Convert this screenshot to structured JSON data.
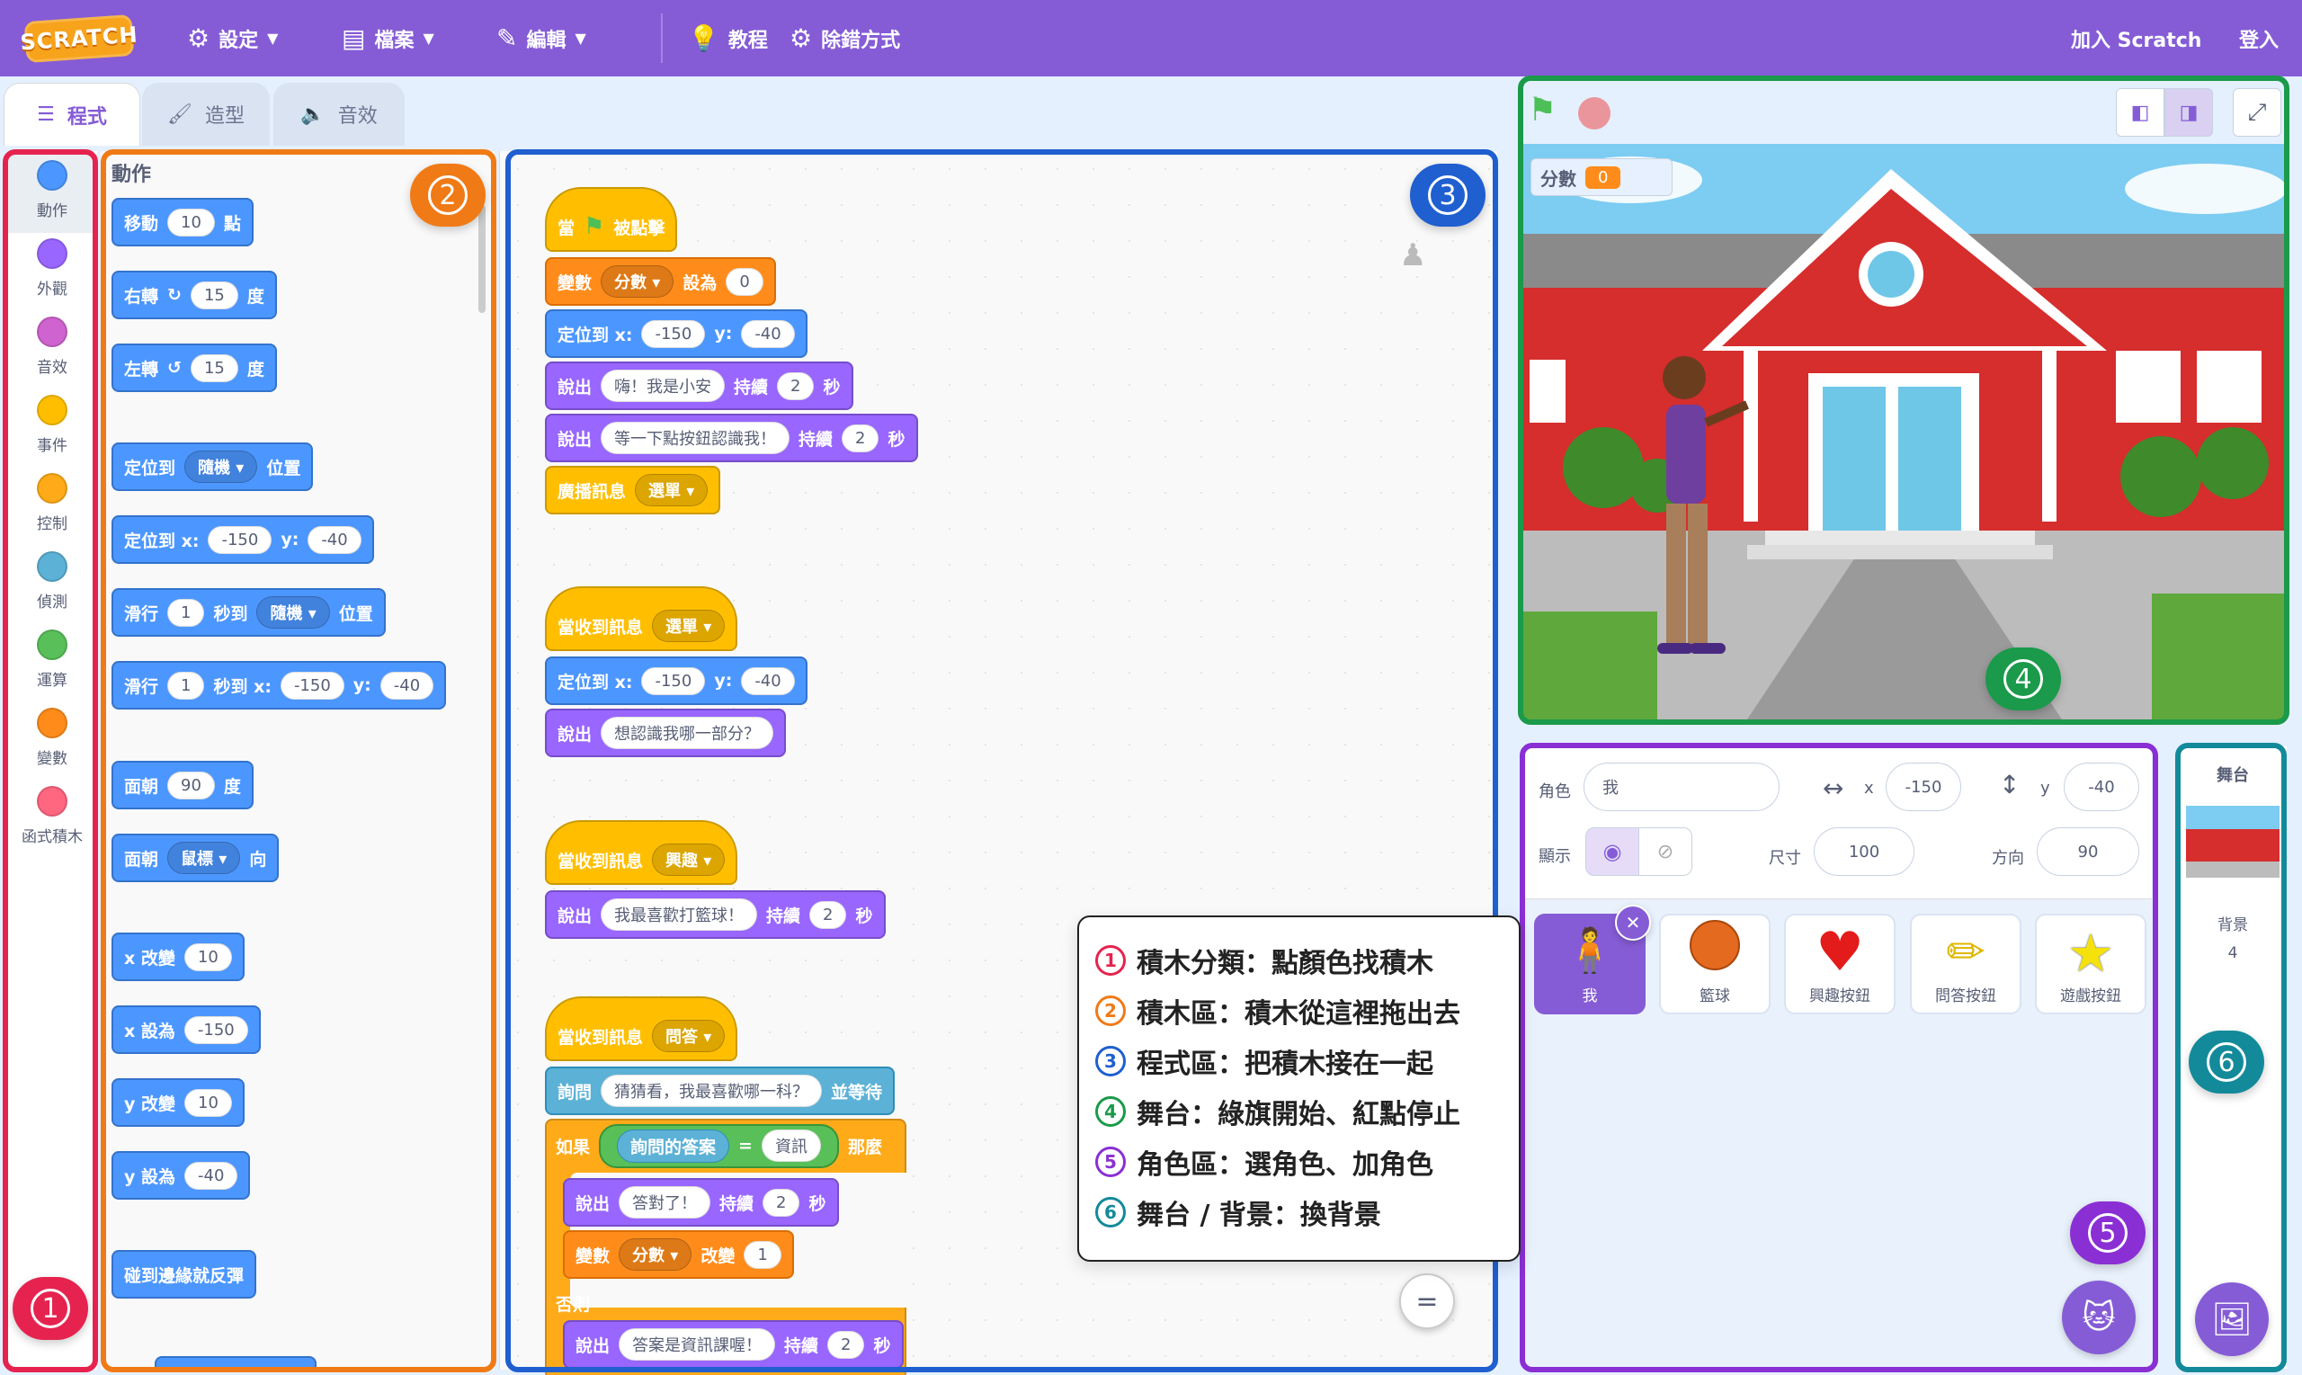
{
  "menubar": {
    "logo": "SCRATCH",
    "settings": "設定",
    "file": "檔案",
    "edit": "編輯",
    "tutorials": "教程",
    "debug": "除錯方式",
    "join": "加入 Scratch",
    "signin": "登入"
  },
  "tabs": {
    "code": "程式",
    "costumes": "造型",
    "sounds": "音效"
  },
  "categories": [
    {
      "label": "動作",
      "color": "#4c97ff"
    },
    {
      "label": "外觀",
      "color": "#9966ff"
    },
    {
      "label": "音效",
      "color": "#cf63cf"
    },
    {
      "label": "事件",
      "color": "#ffbf00"
    },
    {
      "label": "控制",
      "color": "#ffab19"
    },
    {
      "label": "偵測",
      "color": "#5cb1d6"
    },
    {
      "label": "運算",
      "color": "#59c059"
    },
    {
      "label": "變數",
      "color": "#ff8c1a"
    },
    {
      "label": "函式積木",
      "color": "#ff6680"
    }
  ],
  "palette": {
    "title": "動作",
    "move": {
      "a": "移動",
      "v": "10",
      "b": "點"
    },
    "turn_right": {
      "a": "右轉",
      "v": "15",
      "b": "度"
    },
    "turn_left": {
      "a": "左轉",
      "v": "15",
      "b": "度"
    },
    "goto": {
      "a": "定位到",
      "dd": "隨機",
      "b": "位置"
    },
    "gotoxy": {
      "a": "定位到 x:",
      "x": "-150",
      "y_label": "y:",
      "y": "-40"
    },
    "glide": {
      "a": "滑行",
      "v": "1",
      "b": "秒到",
      "dd": "隨機",
      "c": "位置"
    },
    "glidexy": {
      "a": "滑行",
      "v": "1",
      "b": "秒到 x:",
      "x": "-150",
      "y_label": "y:",
      "y": "-40"
    },
    "point": {
      "a": "面朝",
      "v": "90",
      "b": "度"
    },
    "pointto": {
      "a": "面朝",
      "dd": "鼠標",
      "b": "向"
    },
    "changex": {
      "a": "x 改變",
      "v": "10"
    },
    "setx": {
      "a": "x 設為",
      "v": "-150"
    },
    "changey": {
      "a": "y 改變",
      "v": "10"
    },
    "sety": {
      "a": "y 設為",
      "v": "-40"
    },
    "bounce": "碰到邊緣就反彈"
  },
  "scripts": {
    "s1": {
      "hat_a": "當",
      "hat_b": "被點擊",
      "setvar": {
        "a": "變數",
        "dd": "分數",
        "b": "設為",
        "v": "0"
      },
      "goto": {
        "a": "定位到 x:",
        "x": "-150",
        "y_label": "y:",
        "y": "-40"
      },
      "say1": {
        "a": "說出",
        "text": "嗨！我是小安",
        "b": "持續",
        "v": "2",
        "c": "秒"
      },
      "say2": {
        "a": "說出",
        "text": "等一下點按鈕認識我！",
        "b": "持續",
        "v": "2",
        "c": "秒"
      },
      "broadcast": {
        "a": "廣播訊息",
        "dd": "選單"
      }
    },
    "s2": {
      "hat": "當收到訊息",
      "dd": "選單",
      "goto": {
        "a": "定位到 x:",
        "x": "-150",
        "y_label": "y:",
        "y": "-40"
      },
      "say": {
        "a": "說出",
        "text": "想認識我哪一部分？"
      }
    },
    "s3": {
      "hat": "當收到訊息",
      "dd": "興趣",
      "say": {
        "a": "說出",
        "text": "我最喜歡打籃球！",
        "b": "持續",
        "v": "2",
        "c": "秒"
      }
    },
    "s4": {
      "hat": "當收到訊息",
      "dd": "問答",
      "ask": {
        "a": "詢問",
        "text": "猜猜看，我最喜歡哪一科？",
        "b": "並等待"
      },
      "if": {
        "a": "如果",
        "answer": "詢問的答案",
        "eq": "=",
        "val": "資訊",
        "b": "那麼"
      },
      "say_ok": {
        "a": "說出",
        "text": "答對了！",
        "b": "持續",
        "v": "2",
        "c": "秒"
      },
      "change": {
        "a": "變數",
        "dd": "分數",
        "b": "改變",
        "v": "1"
      },
      "else": "否則",
      "say_no": {
        "a": "說出",
        "text": "答案是資訊課喔！",
        "b": "持續",
        "v": "2",
        "c": "秒"
      }
    }
  },
  "stage": {
    "monitor_label": "分數",
    "monitor_value": "0"
  },
  "sprite_info": {
    "sprite_label": "角色",
    "sprite_name": "我",
    "x_label": "x",
    "x": "-150",
    "y_label": "y",
    "y": "-40",
    "show_label": "顯示",
    "size_label": "尺寸",
    "size": "100",
    "dir_label": "方向",
    "dir": "90"
  },
  "sprites": [
    "我",
    "籃球",
    "興趣按鈕",
    "問答按鈕",
    "遊戲按鈕"
  ],
  "stage_pane": {
    "title": "舞台",
    "backdrop_label": "背景",
    "backdrop_count": "4"
  },
  "legend": [
    {
      "num": "1",
      "text": "積木分類：點顏色找積木",
      "color": "#e6234f"
    },
    {
      "num": "2",
      "text": "積木區：積木從這裡拖出去",
      "color": "#f07a16"
    },
    {
      "num": "3",
      "text": "程式區：把積木接在一起",
      "color": "#1f5fcf"
    },
    {
      "num": "4",
      "text": "舞台：綠旗開始、紅點停止",
      "color": "#1a9a4a"
    },
    {
      "num": "5",
      "text": "角色區：選角色、加角色",
      "color": "#8a2fd4"
    },
    {
      "num": "6",
      "text": "舞台 / 背景：換背景",
      "color": "#138a9a"
    }
  ],
  "badges": [
    "1",
    "2",
    "3",
    "4",
    "5",
    "6"
  ],
  "colors": {
    "accent": "#855cd6",
    "hl1": "#e6234f",
    "hl2": "#f07a16",
    "hl3": "#1f5fcf",
    "hl4": "#1a9a4a",
    "hl5": "#8a2fd4",
    "hl6": "#138a9a"
  }
}
